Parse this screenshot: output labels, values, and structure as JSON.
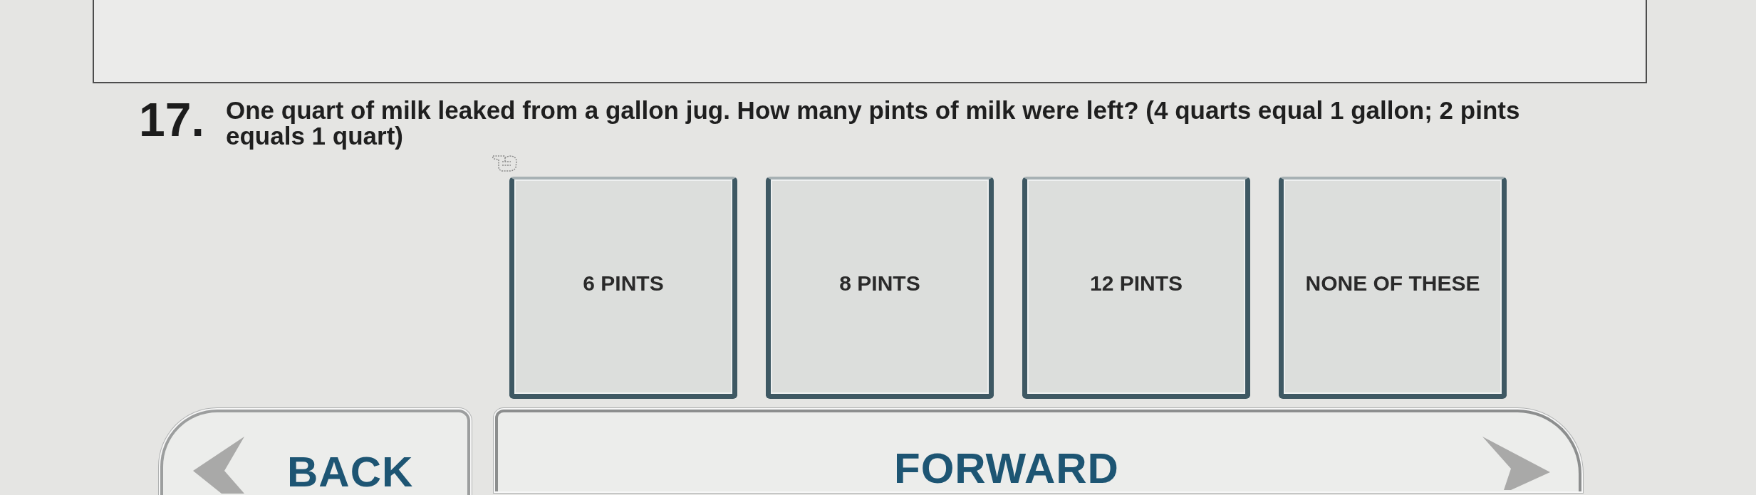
{
  "question": {
    "number": "17.",
    "text": "One quart of milk leaked from a gallon jug. How many pints of milk were left? (4 quarts equal 1 gallon; 2 pints equals 1 quart)"
  },
  "answers": [
    {
      "label": "6 PINTS",
      "selected": false
    },
    {
      "label": "8 PINTS",
      "selected": false
    },
    {
      "label": "12 PINTS",
      "selected": false
    },
    {
      "label": "NONE OF THESE",
      "selected": false
    }
  ],
  "navigation": [
    {
      "label": "BACK",
      "kind": "back"
    },
    {
      "label": "FORWARD",
      "kind": "forward"
    }
  ]
}
